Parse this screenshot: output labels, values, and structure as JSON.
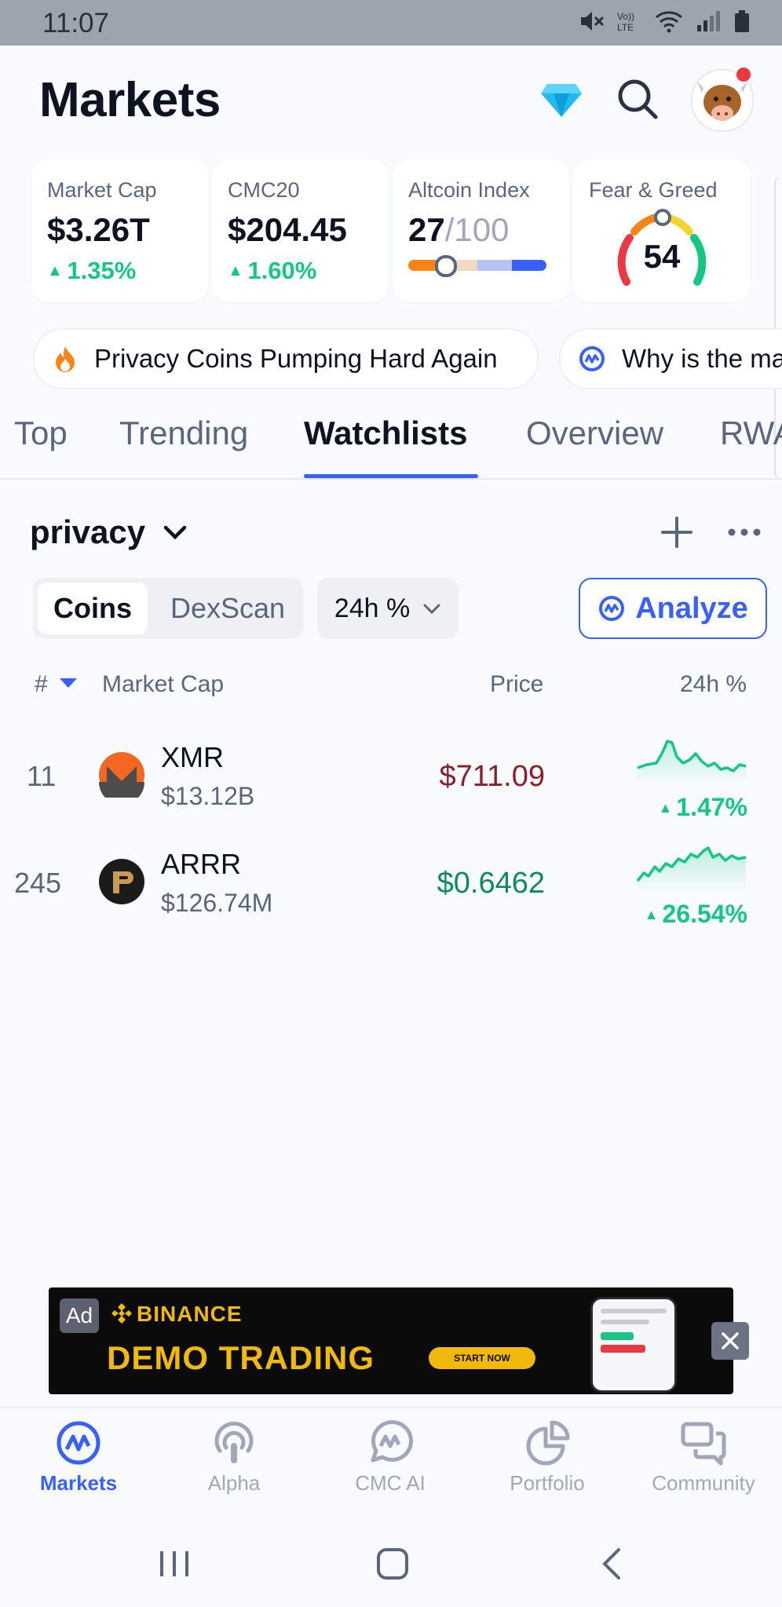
{
  "status": {
    "time": "11:07"
  },
  "header": {
    "title": "Markets"
  },
  "cards": [
    {
      "label": "Market Cap",
      "value": "$3.26T",
      "change": "1.35%"
    },
    {
      "label": "CMC20",
      "value": "$204.45",
      "change": "1.60%"
    },
    {
      "label": "Altcoin Index",
      "value": "27",
      "value_suffix": "/100",
      "index_value": 27,
      "index_max": 100
    },
    {
      "label": "Fear & Greed",
      "value": "54"
    }
  ],
  "news": [
    {
      "text": "Privacy Coins Pumping Hard Again",
      "icon": "fire-icon"
    },
    {
      "text": "Why is the ma",
      "icon": "cmc-ai-icon"
    }
  ],
  "tabs": [
    "Top",
    "Trending",
    "Watchlists",
    "Overview",
    "RWA"
  ],
  "active_tab": "Watchlists",
  "watchlist": {
    "name": "privacy",
    "segments": [
      "Coins",
      "DexScan"
    ],
    "period": "24h %",
    "analyze_label": "Analyze",
    "columns": {
      "rank": "#",
      "market_cap": "Market Cap",
      "price": "Price",
      "change": "24h %"
    },
    "rows": [
      {
        "rank": "11",
        "symbol": "XMR",
        "market_cap": "$13.12B",
        "price": "$711.09",
        "change": "1.47%",
        "price_color": "#8a1f2b"
      },
      {
        "rank": "245",
        "symbol": "ARRR",
        "market_cap": "$126.74M",
        "price": "$0.6462",
        "change": "26.54%",
        "price_color": "#0f8a5f"
      }
    ]
  },
  "ad": {
    "badge": "Ad",
    "brand": "BINANCE",
    "headline": "DEMO TRADING",
    "cta": "START NOW"
  },
  "nav": [
    {
      "label": "Markets",
      "icon": "markets-icon"
    },
    {
      "label": "Alpha",
      "icon": "alpha-icon"
    },
    {
      "label": "CMC AI",
      "icon": "cmc-ai-icon"
    },
    {
      "label": "Portfolio",
      "icon": "portfolio-icon"
    },
    {
      "label": "Community",
      "icon": "community-icon"
    }
  ],
  "colors": {
    "accent": "#3861fb",
    "up": "#16c784",
    "ad_yellow": "#f0b90b"
  }
}
